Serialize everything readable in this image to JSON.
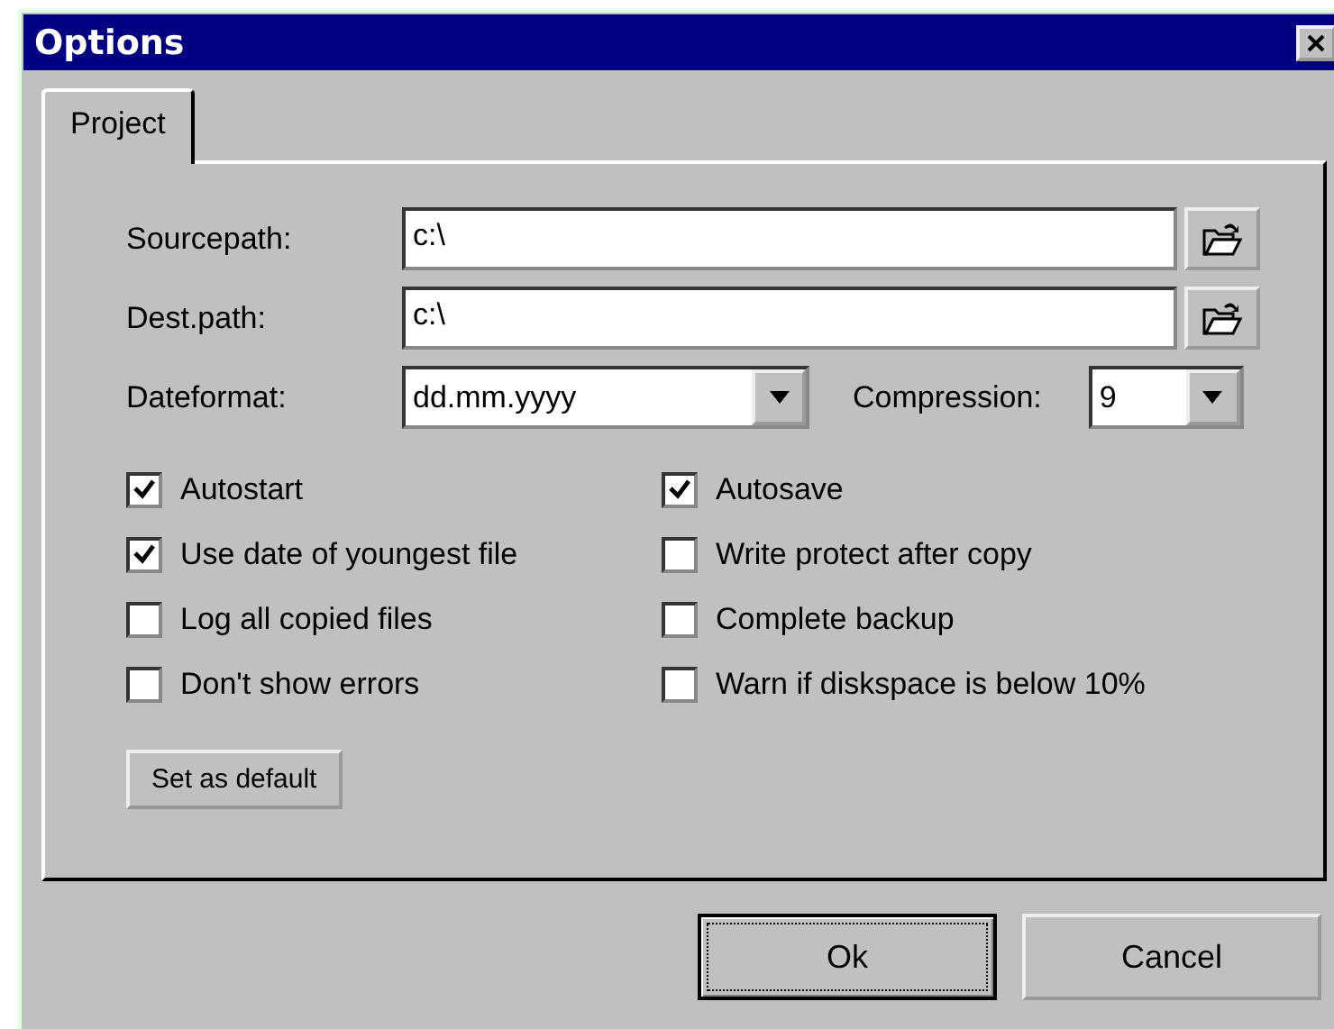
{
  "window": {
    "title": "Options"
  },
  "tabs": [
    {
      "label": "Project",
      "selected": true
    }
  ],
  "paths": [
    {
      "label": "Sourcepath:",
      "value": "c:\\"
    },
    {
      "label": "Dest.path:",
      "value": "c:\\"
    }
  ],
  "dateformat": {
    "label": "Dateformat:",
    "value": "dd.mm.yyyy"
  },
  "compression": {
    "label": "Compression:",
    "value": "9"
  },
  "checkbox_columns": [
    [
      {
        "label": "Autostart",
        "checked": true
      },
      {
        "label": "Use date of youngest file",
        "checked": true
      },
      {
        "label": "Log all copied files",
        "checked": false
      },
      {
        "label": "Don't show errors",
        "checked": false
      }
    ],
    [
      {
        "label": "Autosave",
        "checked": true
      },
      {
        "label": "Write protect after copy",
        "checked": false
      },
      {
        "label": "Complete backup",
        "checked": false
      },
      {
        "label": "Warn if diskspace is below 10%",
        "checked": false
      }
    ]
  ],
  "default_button": "Set as default",
  "buttons": [
    {
      "label": "Ok",
      "focused": true
    },
    {
      "label": "Cancel",
      "focused": false
    }
  ]
}
